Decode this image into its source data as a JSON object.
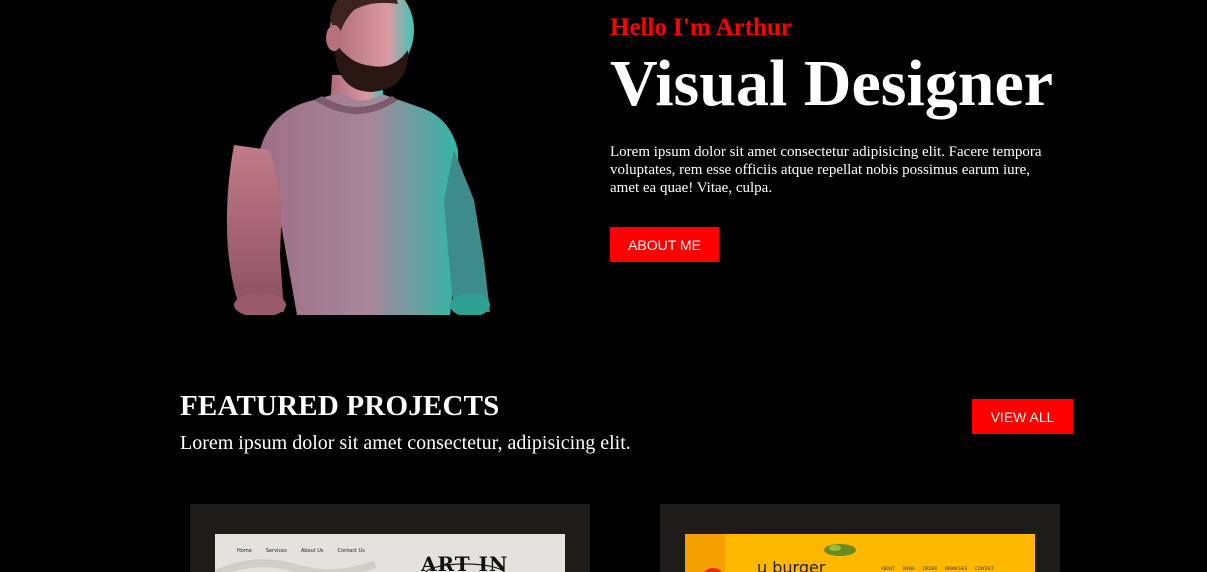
{
  "hero": {
    "greeting": "Hello I'm Arthur",
    "title": "Visual Designer",
    "description": "Lorem ipsum dolor sit amet consectetur adipisicing elit. Facere tempora voluptates, rem esse officiis atque repellat nobis possimus earum iure, amet ea quae! Vitae, culpa.",
    "about_button": "ABOUT ME"
  },
  "featured": {
    "title": "FEATURED PROJECTS",
    "subtitle": "Lorem ipsum dolor sit amet consectetur, adipisicing elit.",
    "view_all_button": "VIEW ALL"
  },
  "projects": [
    {
      "nav": [
        "Home",
        "Services",
        "About Us",
        "Contact Us"
      ],
      "headline": "ART IN"
    },
    {
      "logo": "u burger",
      "nav": [
        "ABOUT",
        "MENU",
        "ORDER",
        "BRANCHES",
        "CONTACT"
      ]
    }
  ],
  "colors": {
    "accent": "#ff0000",
    "background": "#000000",
    "card": "#1e1b1b"
  }
}
